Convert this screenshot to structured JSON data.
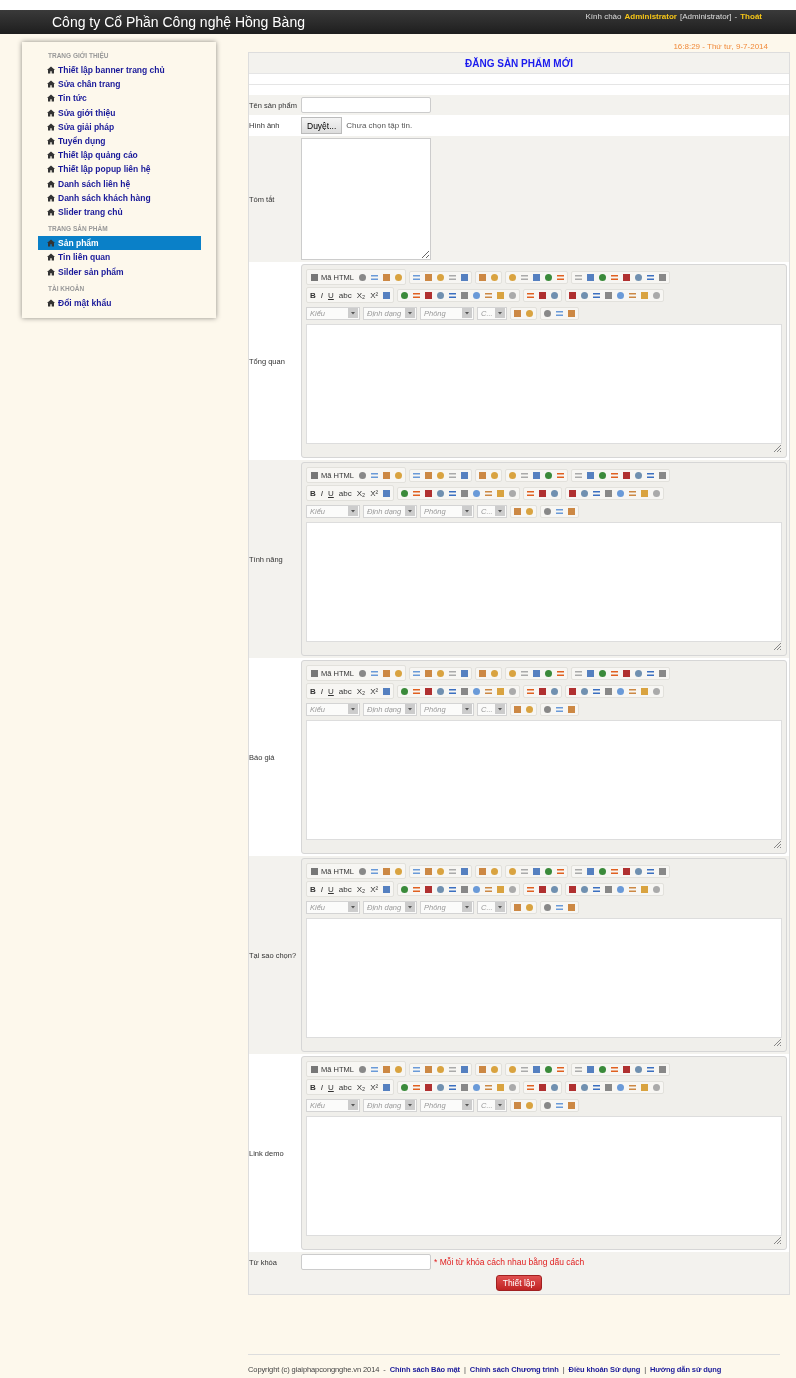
{
  "header": {
    "title": "Công ty Cổ Phần Công nghệ Hồng Bàng",
    "greeting": "Kính chào",
    "user": "Administrator",
    "role": "[Administrator]",
    "separator": "-",
    "logout": "Thoát"
  },
  "sidebar": {
    "sections": [
      {
        "heading": "TRANG GIỚI THIỆU",
        "items": [
          {
            "label": "Thiết lập banner trang chủ",
            "selected": false
          },
          {
            "label": "Sửa chân trang",
            "selected": false
          },
          {
            "label": "Tin tức",
            "selected": false
          },
          {
            "label": "Sửa giới thiệu",
            "selected": false
          },
          {
            "label": "Sửa giải pháp",
            "selected": false
          },
          {
            "label": "Tuyển dụng",
            "selected": false
          },
          {
            "label": "Thiết lập quảng cáo",
            "selected": false
          },
          {
            "label": "Thiết lập popup liên hệ",
            "selected": false
          },
          {
            "label": "Danh sách liên hệ",
            "selected": false
          },
          {
            "label": "Danh sách khách hàng",
            "selected": false
          },
          {
            "label": "Slider trang chủ",
            "selected": false
          }
        ]
      },
      {
        "heading": "TRANG SẢN PHẨM",
        "items": [
          {
            "label": "Sản phẩm",
            "selected": true
          },
          {
            "label": "Tin liên quan",
            "selected": false
          },
          {
            "label": "Silder sản phẩm",
            "selected": false
          }
        ]
      },
      {
        "heading": "TÀI KHOẢN",
        "items": [
          {
            "label": "Đổi mật khẩu",
            "selected": false
          }
        ]
      }
    ]
  },
  "datetime": "16:8:29 - Thứ tư, 9-7-2014",
  "form": {
    "title": "ĐĂNG SẢN PHẨM MỚI",
    "rows": [
      {
        "kind": "text",
        "label": "Tên sản phẩm"
      },
      {
        "kind": "file",
        "label": "Hình ảnh",
        "button": "Duyệt...",
        "status": "Chưa chọn tập tin."
      },
      {
        "kind": "textarea",
        "label": "Tóm tắt"
      },
      {
        "kind": "editor",
        "label": "Tổng quan",
        "toolbar": {
          "source": "Mã HTML",
          "format": [
            "B",
            "I",
            "U",
            "abc",
            "X₂",
            "X²"
          ],
          "dropdowns": [
            "Kiểu",
            "Định dạng",
            "Phông",
            "C..."
          ]
        }
      },
      {
        "kind": "editor",
        "label": "Tính năng",
        "toolbar": {
          "source": "Mã HTML",
          "format": [
            "B",
            "I",
            "U",
            "abc",
            "X₂",
            "X²"
          ],
          "dropdowns": [
            "Kiểu",
            "Định dạng",
            "Phông",
            "C..."
          ]
        }
      },
      {
        "kind": "editor",
        "label": "Báo giá",
        "toolbar": {
          "source": "Mã HTML",
          "format": [
            "B",
            "I",
            "U",
            "abc",
            "X₂",
            "X²"
          ],
          "dropdowns": [
            "Kiểu",
            "Định dạng",
            "Phông",
            "C..."
          ]
        }
      },
      {
        "kind": "editor",
        "label": "Tại sao chọn?",
        "toolbar": {
          "source": "Mã HTML",
          "format": [
            "B",
            "I",
            "U",
            "abc",
            "X₂",
            "X²"
          ],
          "dropdowns": [
            "Kiểu",
            "Định dạng",
            "Phông",
            "C..."
          ]
        }
      },
      {
        "kind": "editor",
        "label": "Link demo",
        "toolbar": {
          "source": "Mã HTML",
          "format": [
            "B",
            "I",
            "U",
            "abc",
            "X₂",
            "X²"
          ],
          "dropdowns": [
            "Kiểu",
            "Định dạng",
            "Phông",
            "C..."
          ]
        }
      },
      {
        "kind": "keyword",
        "label": "Từ khóa",
        "hint": "* Mỗi từ khóa cách nhau bằng dấu cách"
      }
    ],
    "submit": "Thiết lập"
  },
  "footer": {
    "copyright": "Copyright (c) giaiphapcongnghe.vn 2014",
    "dash": "-",
    "separator": "|",
    "links": [
      "Chính sách Bảo mật",
      "Chính sách Chương trình",
      "Điều khoản Sử dụng",
      "Hướng dẫn sử dụng"
    ]
  }
}
